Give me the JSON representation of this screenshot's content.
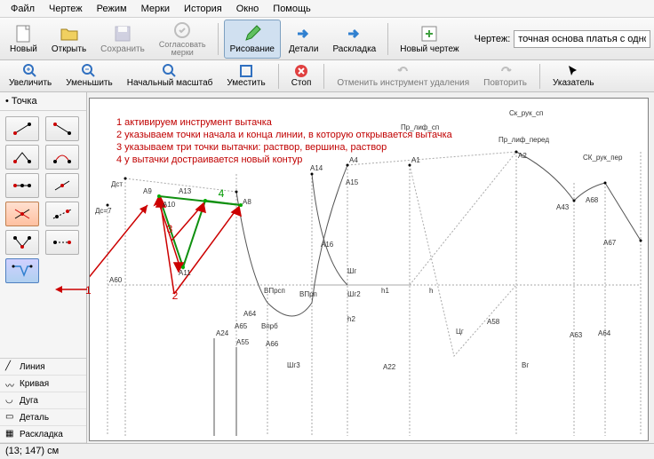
{
  "menu": {
    "items": [
      "Файл",
      "Чертеж",
      "Режим",
      "Мерки",
      "История",
      "Окно",
      "Помощь"
    ]
  },
  "toolbar1": {
    "new": "Новый",
    "open": "Открыть",
    "save": "Сохранить",
    "match": "Согласовать\nмерки",
    "draw": "Рисование",
    "detail": "Детали",
    "layout": "Раскладка",
    "newdraw": "Новый чертеж",
    "drawLabel": "Чертеж:",
    "drawValue": "точная основа платья с одношовным рука"
  },
  "toolbar2": {
    "zoomin": "Увеличить",
    "zoomout": "Уменьшить",
    "zoomfit": "Начальный масштаб",
    "fit": "Уместить",
    "stop": "Стоп",
    "undo": "Отменить инструмент удаления",
    "redo": "Повторить",
    "pointer": "Указатель"
  },
  "sidebar": {
    "header": "Точка",
    "tabs": {
      "line": "Линия",
      "curve": "Кривая",
      "arc": "Дуга",
      "detail": "Деталь",
      "layout": "Раскладка"
    }
  },
  "annotations": [
    "1 активируем инструмент вытачка",
    "2 указываем точки начала и конца линии, в которую открывается вытачка",
    "3 указываем три точки вытачки: раствор, вершина, раствор",
    "4 у вытачки достраивается новый контур"
  ],
  "annotNums": {
    "n1": "1",
    "n2": "2",
    "n3": "3",
    "n4": "4"
  },
  "points": {
    "sk_ruk_sp": "Ск_рук_сп",
    "pr_lif_sp": "Пр_лиф_сп",
    "pr_lif_pered": "Пр_лиф_перед",
    "sk_ruk_per": "СК_рук_пер",
    "A1": "А1",
    "A2": "А2",
    "A4": "А4",
    "A8": "А8",
    "A9": "А9",
    "A10": "А10",
    "A11": "А11",
    "A13": "А13",
    "A14": "А14",
    "A15": "А15",
    "A16": "А16",
    "A22": "А22",
    "A24": "А24",
    "A43": "А43",
    "A55": "А55",
    "A58": "А58",
    "A60": "А60",
    "A63": "А63",
    "A64": "А64",
    "A65": "А65",
    "A66": "А66",
    "A67": "А67",
    "A68": "А68",
    "Dst": "Дст",
    "Dst7": "Дс=7",
    "Shg": "Шг",
    "Shg2": "Шг2",
    "Shg3": "Шг3",
    "h": "h",
    "h1": "h1",
    "h2": "h2",
    "Cg": "Цг",
    "Bg": "Вг",
    "VPrsp": "ВПрсп",
    "VPrp": "ВПрп",
    "VPrb": "Впрб"
  },
  "status": "(13; 147) см"
}
